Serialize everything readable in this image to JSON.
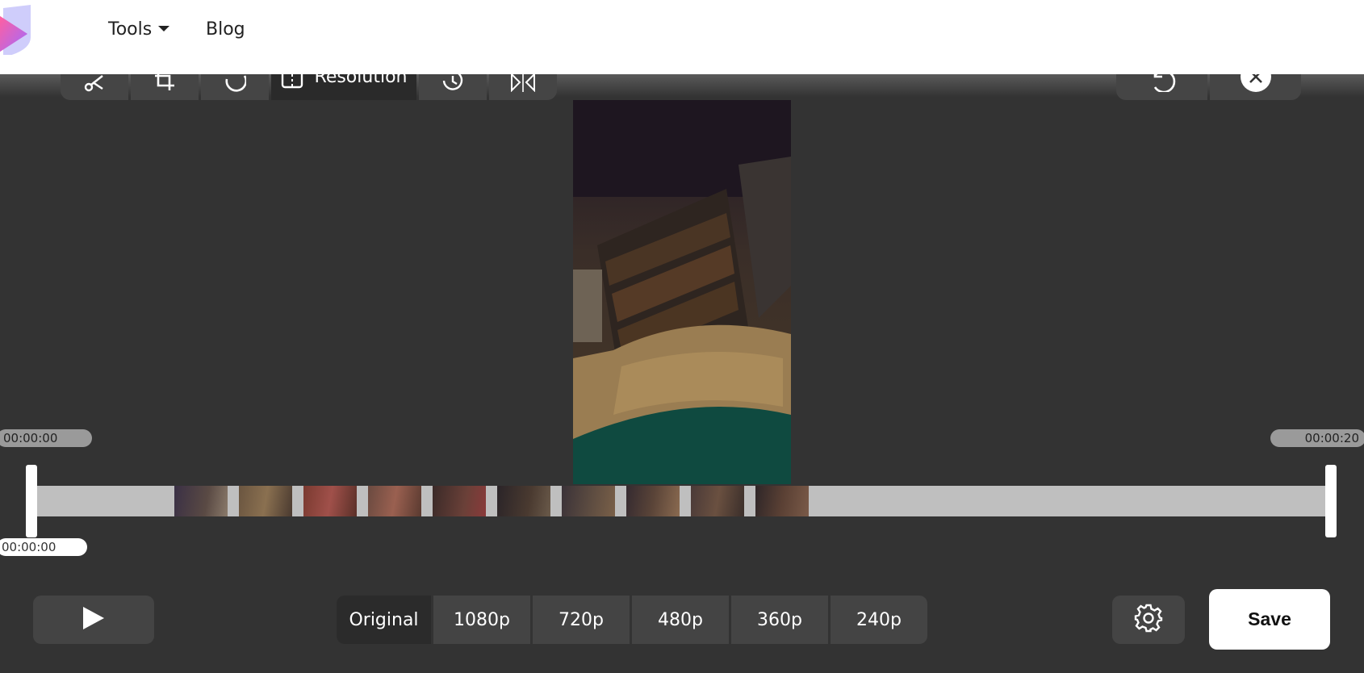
{
  "header": {
    "nav": [
      {
        "label": "Tools"
      },
      {
        "label": "Blog"
      }
    ]
  },
  "toolbar": {
    "tools": [
      {
        "icon": "scissors-icon"
      },
      {
        "icon": "crop-icon"
      },
      {
        "icon": "rotate-icon"
      },
      {
        "icon": "resolution-icon",
        "label": "Resolution",
        "active": true
      },
      {
        "icon": "speed-icon"
      },
      {
        "icon": "flip-icon"
      }
    ],
    "right": [
      {
        "icon": "undo-icon"
      },
      {
        "icon": "close-icon"
      }
    ]
  },
  "timeline": {
    "start_time": "00:00:00",
    "end_time": "00:00:20",
    "current_time": "00:00:00"
  },
  "controls": {
    "play_icon": "play-icon",
    "resolutions": [
      "Original",
      "1080p",
      "720p",
      "480p",
      "360p",
      "240p"
    ],
    "selected_resolution": "Original",
    "settings_icon": "gear-icon",
    "save_label": "Save"
  },
  "colors": {
    "background": "#333333",
    "button": "#444444",
    "active_button": "#2b2b2b",
    "timeline_track": "#bfbfbf"
  }
}
